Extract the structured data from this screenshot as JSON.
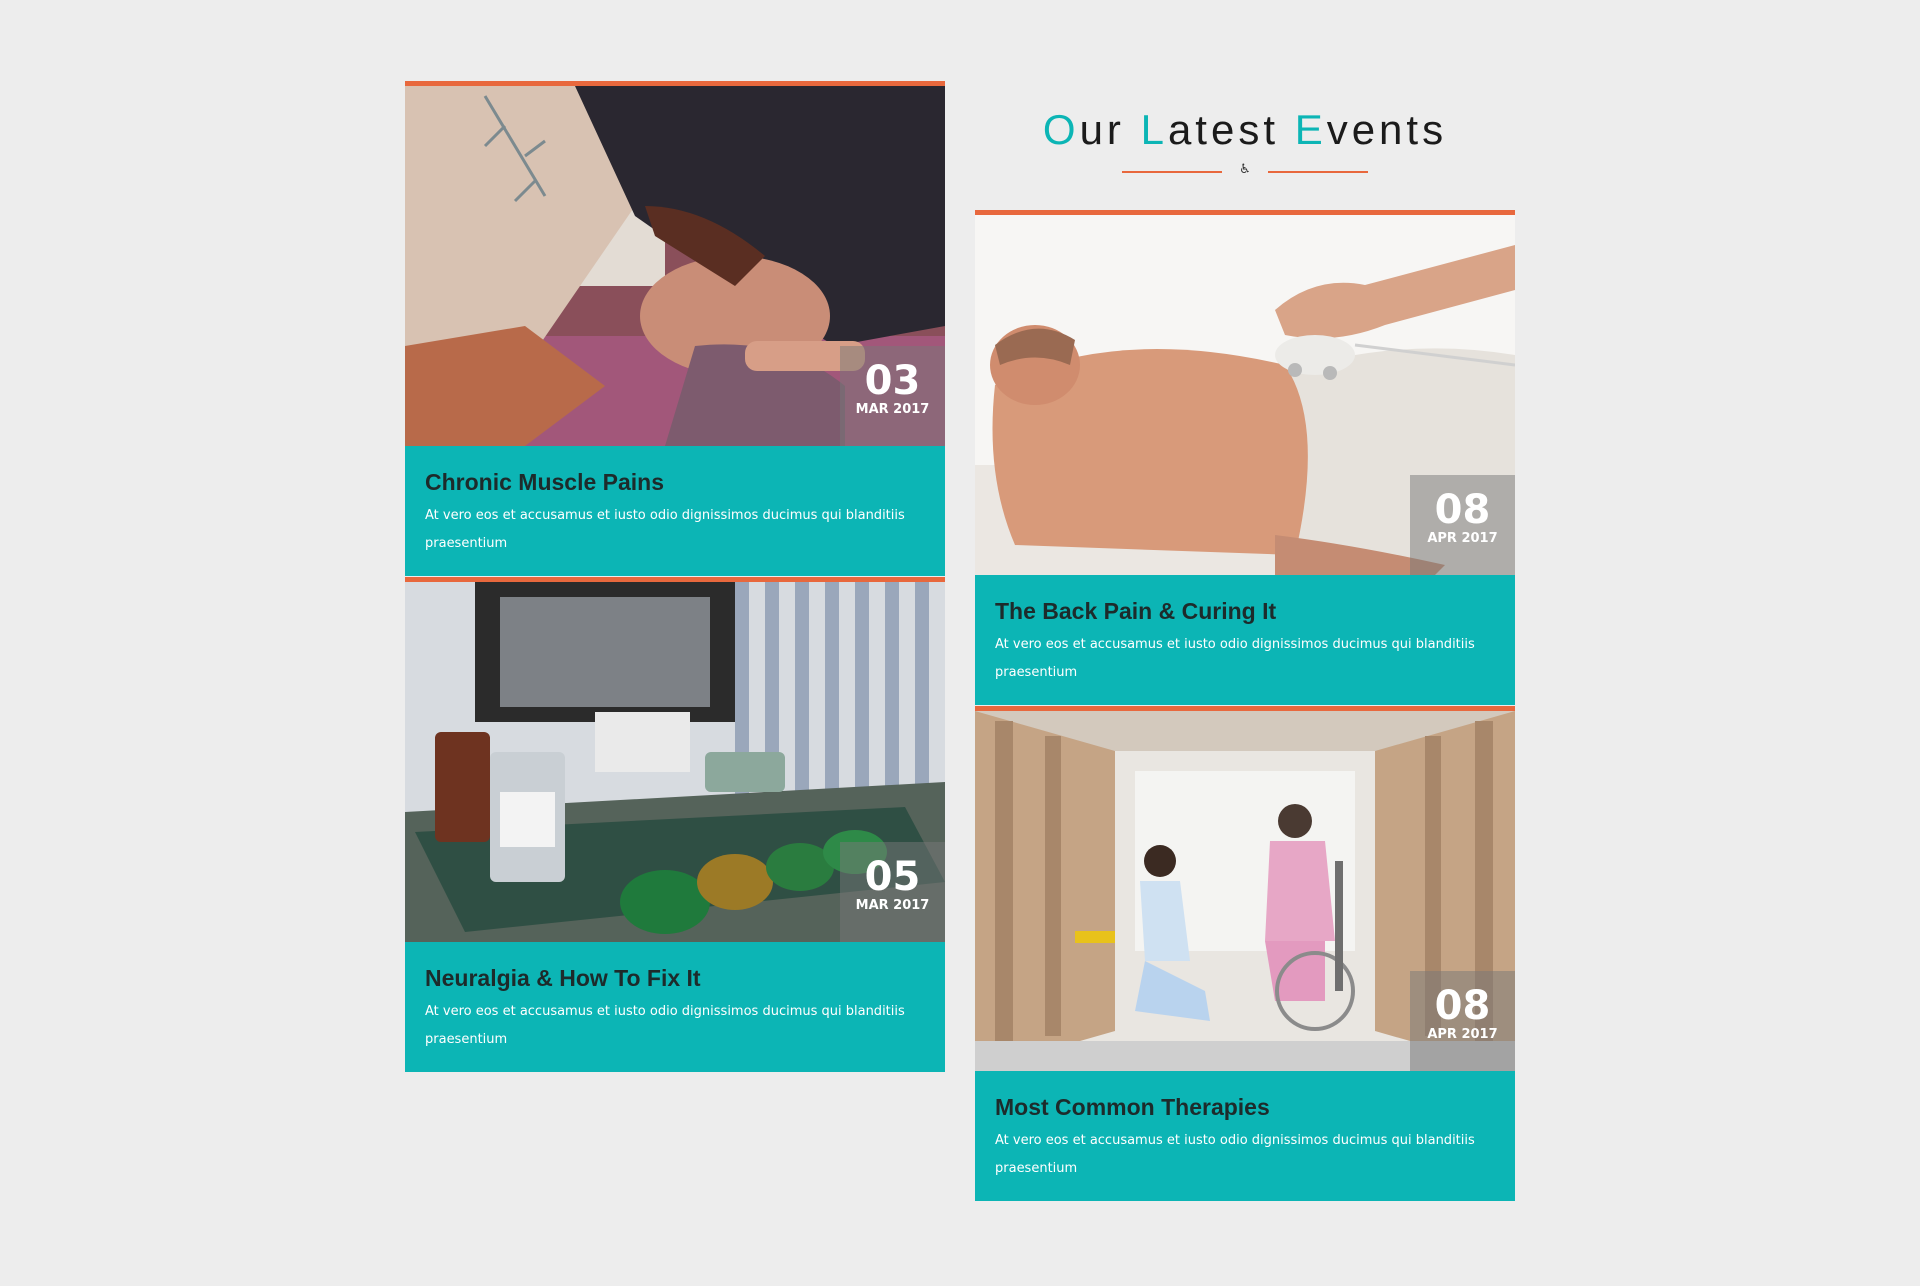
{
  "heading": {
    "words": [
      {
        "cap": "O",
        "rest": "ur"
      },
      {
        "cap": "L",
        "rest": "atest"
      },
      {
        "cap": "E",
        "rest": "vents"
      }
    ],
    "divider_icon": "wheelchair-icon"
  },
  "events": [
    {
      "title": "Chronic Muscle Pains",
      "description": "At vero eos et accusamus et iusto odio dignissimos ducimus qui blanditiis praesentium",
      "day": "03",
      "month_year": "MAR 2017",
      "image": "massage-woman-photo"
    },
    {
      "title": "Neuralgia & How To Fix It",
      "description": "At vero eos et accusamus et iusto odio dignissimos ducimus qui blanditiis praesentium",
      "day": "05",
      "month_year": "MAR 2017",
      "image": "medical-tray-photo"
    },
    {
      "title": "The Back Pain & Curing It",
      "description": "At vero eos et accusamus et iusto odio dignissimos ducimus qui blanditiis praesentium",
      "day": "08",
      "month_year": "APR 2017",
      "image": "back-therapy-photo"
    },
    {
      "title": "Most Common Therapies",
      "description": "At vero eos et accusamus et iusto odio dignissimos ducimus qui blanditiis praesentium",
      "day": "08",
      "month_year": "APR 2017",
      "image": "nurse-wheelchair-photo"
    }
  ],
  "colors": {
    "accent": "#0cb5b5",
    "border": "#e8683d",
    "background": "#ededed"
  }
}
